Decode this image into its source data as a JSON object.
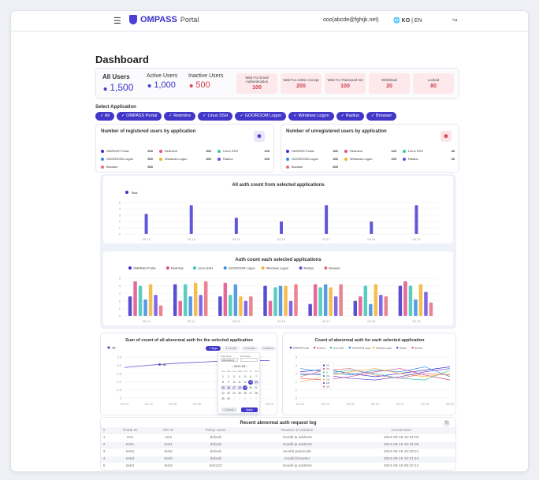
{
  "header": {
    "brand": "OMPASS",
    "portal": "Portal",
    "email": "ooo(abcde@fghijk.net)",
    "lang_ko": "KO",
    "lang_sep": "|",
    "lang_en": "EN"
  },
  "page_title": "Dashboard",
  "stats": {
    "all_users": {
      "label": "All Users",
      "value": "1,500"
    },
    "active_users": {
      "label": "Active Users",
      "value": "1,000"
    },
    "inactive_users": {
      "label": "Inactive Users",
      "value": "500"
    },
    "pending": [
      {
        "label": "Wait For Email Authentication",
        "value": "100"
      },
      {
        "label": "Wait For Admin Accept",
        "value": "200"
      },
      {
        "label": "Wait For Password Init",
        "value": "100"
      },
      {
        "label": "Withdrawl",
        "value": "20"
      },
      {
        "label": "Locked",
        "value": "80"
      }
    ]
  },
  "select_application_label": "Select Application",
  "applications": [
    "All",
    "OMPASS Portal",
    "Redmine",
    "Linux SSH",
    "GOOROOM Logon",
    "Windows Logon",
    "Radius",
    "Browser"
  ],
  "colors": {
    "accent": "#4137c9",
    "danger": "#d23c4c",
    "app_colors": [
      "#3b30c9",
      "#e04f8a",
      "#3cc6b4",
      "#3a8be0",
      "#f2b431",
      "#6b4fe0",
      "#e86d7c"
    ]
  },
  "registered": {
    "title": "Number of registered users by application",
    "rows": [
      {
        "name": "OMPASS Portal",
        "value": "600",
        "color": "#3b30c9"
      },
      {
        "name": "Redmine",
        "value": "300",
        "color": "#e04f8a"
      },
      {
        "name": "Linux SSH",
        "value": "100",
        "color": "#3cc6b4"
      },
      {
        "name": "GOOROOM Logon",
        "value": "600",
        "color": "#3a8be0"
      },
      {
        "name": "Windows Logon",
        "value": "300",
        "color": "#f2b431"
      },
      {
        "name": "Radius",
        "value": "100",
        "color": "#6b4fe0"
      },
      {
        "name": "Browser",
        "value": "600",
        "color": "#e86d7c"
      }
    ]
  },
  "unregistered": {
    "title": "Number of unregistered users by application",
    "rows": [
      {
        "name": "OMPASS Portal",
        "value": "300",
        "color": "#3b30c9"
      },
      {
        "name": "Redmine",
        "value": "100",
        "color": "#e04f8a"
      },
      {
        "name": "Linux SSH",
        "value": "40",
        "color": "#3cc6b4"
      },
      {
        "name": "GOOROOM Logon",
        "value": "300",
        "color": "#3a8be0"
      },
      {
        "name": "Windows Logon",
        "value": "100",
        "color": "#f2b431"
      },
      {
        "name": "Radius",
        "value": "40",
        "color": "#6b4fe0"
      },
      {
        "name": "Browser",
        "value": "600",
        "color": "#e86d7c"
      }
    ]
  },
  "chart_data": [
    {
      "type": "bar",
      "title": "All auth count from selected applications",
      "series": [
        {
          "name": "Total",
          "values": [
            3.2,
            4.6,
            2.6,
            2,
            4.6,
            2,
            4.6
          ]
        }
      ],
      "categories": [
        "09.13",
        "09.14",
        "09.15",
        "09.16",
        "09.17",
        "09.18",
        "09.19"
      ],
      "ylim": [
        0,
        5
      ],
      "yticks": [
        "0",
        "1",
        "2",
        "3",
        "4",
        "5"
      ]
    },
    {
      "type": "bar",
      "title": "Auth count each selected applications",
      "categories": [
        "09.13",
        "09.14",
        "09.15",
        "09.16",
        "09.17",
        "09.18",
        "09.19"
      ],
      "ylim": [
        0,
        5
      ],
      "yticks": [
        "0",
        "1",
        "2",
        "3",
        "4",
        "5"
      ],
      "series": [
        {
          "name": "OMPASS Portal",
          "values": [
            2.6,
            4.2,
            2.6,
            4,
            1.6,
            2,
            4
          ]
        },
        {
          "name": "Redmine",
          "values": [
            4.6,
            2,
            4.4,
            2,
            4.2,
            2.6,
            4.6
          ]
        },
        {
          "name": "Linux SSH",
          "values": [
            4,
            4.2,
            2.8,
            3.8,
            3.8,
            4,
            4
          ]
        },
        {
          "name": "GOOROOM Logon",
          "values": [
            2.2,
            2.6,
            4.2,
            4,
            4.2,
            1.6,
            2.2
          ]
        },
        {
          "name": "Windows Logon",
          "values": [
            4.2,
            4.4,
            2.6,
            4,
            3.8,
            4.2,
            4.2
          ]
        },
        {
          "name": "Radius",
          "values": [
            2.8,
            2.8,
            2,
            2,
            2.6,
            2.8,
            3.2
          ]
        },
        {
          "name": "Browser",
          "values": [
            1.4,
            4.6,
            2.6,
            4.2,
            4.2,
            2.6,
            1.8
          ]
        }
      ]
    },
    {
      "type": "line",
      "title": "Sum of count of all abnormal auth for the selected application",
      "categories": [
        "09.13",
        "09.14",
        "09.15",
        "09.16",
        "09.17",
        "09.18",
        "09.19"
      ],
      "yticks": [
        "0",
        "1.5",
        "2.0",
        "2.5",
        "3.0",
        "3.5"
      ],
      "series": [
        {
          "name": "All",
          "values": [
            2.6,
            2.8,
            2.95,
            3.05,
            3.15,
            3.2,
            3.2
          ]
        }
      ],
      "tooltip": {
        "label": "All"
      }
    },
    {
      "type": "line",
      "title": "Count of abnormal auth for each selected application",
      "categories": [
        "09.13",
        "09.14",
        "09.15",
        "09.16",
        "09.17",
        "09.18",
        "09.19"
      ],
      "yticks": [
        "0",
        "1",
        "2",
        "3",
        "4",
        "5"
      ],
      "series": [
        {
          "name": "OMPASS Portal",
          "values": [
            3.2,
            3.5,
            3,
            2.6,
            3,
            3.4,
            3.8
          ]
        },
        {
          "name": "Redmine",
          "values": [
            2.4,
            2.2,
            2.6,
            3.2,
            3.6,
            2.8,
            2.2
          ]
        },
        {
          "name": "Linux SSH",
          "values": [
            2.8,
            3,
            3.4,
            3,
            2.4,
            2.2,
            3.4
          ]
        },
        {
          "name": "GOOROOM Logon",
          "values": [
            3.6,
            3.2,
            2.8,
            3.4,
            3.2,
            3.8,
            2.6
          ]
        },
        {
          "name": "Windows Logon",
          "values": [
            2,
            2.6,
            3.2,
            3.6,
            3,
            2.6,
            3
          ]
        },
        {
          "name": "Radius",
          "values": [
            3,
            2.8,
            2.4,
            2.2,
            2.6,
            3.2,
            3.6
          ]
        },
        {
          "name": "Browser",
          "values": [
            2.6,
            3.4,
            3.6,
            2.8,
            2.4,
            3,
            2.8
          ]
        }
      ]
    }
  ],
  "abnormal_sum": {
    "tabs": [
      "7 days",
      "1 month",
      "3 month",
      "Custom"
    ],
    "calendar": {
      "start_label": "Start Date",
      "end_label": "End Date",
      "start_value": "2024-09-13",
      "month": "2024.09",
      "weekdays": [
        "Sun",
        "Mon",
        "Tue",
        "Wed",
        "Thu",
        "Fri",
        "Sat"
      ],
      "days": [
        "1",
        "2",
        "3",
        "4",
        "5",
        "6",
        "7",
        "8",
        "9",
        "10",
        "11",
        "12",
        "13",
        "14",
        "15",
        "16",
        "17",
        "18",
        "19",
        "20",
        "21",
        "22",
        "23",
        "24",
        "25",
        "26",
        "27",
        "28",
        "29",
        "30",
        "1",
        "2",
        "3",
        "4",
        "5"
      ],
      "cancel": "Cancel",
      "apply": "Apply"
    }
  },
  "table": {
    "title": "Recent abnormal auth request log",
    "headers": [
      "#",
      "Portal ID",
      "RP ID",
      "Policy name",
      "Reason of violation",
      "Access time"
    ],
    "rows": [
      [
        "1",
        "omc",
        "omo",
        "default",
        "Invalid ip address",
        "2024-09-18 10:34:05"
      ],
      [
        "2",
        "test1",
        "test1",
        "default",
        "Invalid ip address",
        "2024-09-18 10:34:06"
      ],
      [
        "3",
        "test2",
        "test2",
        "default",
        "Invalid passcode",
        "2024-09-18 10:33:21"
      ],
      [
        "4",
        "test3",
        "test3",
        "default",
        "Invalid browser",
        "2024-09-18 10:31:44"
      ],
      [
        "5",
        "test4",
        "test4",
        "test123",
        "Invalid ip address",
        "2024-09-18 09:40:12"
      ]
    ]
  }
}
